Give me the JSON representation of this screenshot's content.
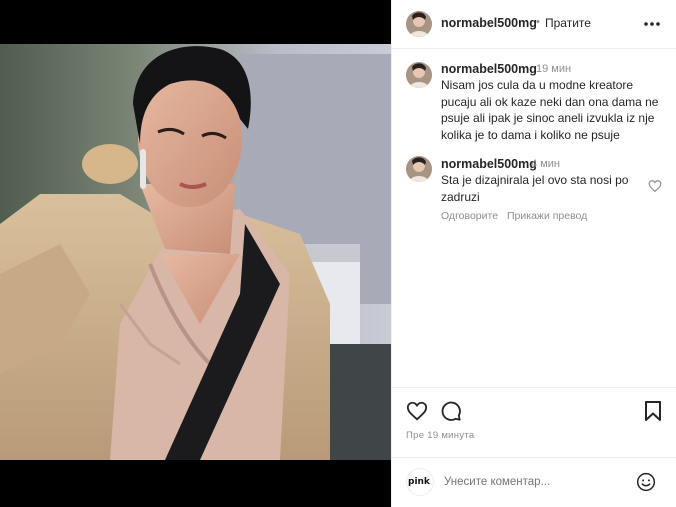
{
  "post": {
    "username": "normabel500mg",
    "dot": "•",
    "follow_label": "Пратите",
    "more_icon": "more-horizontal-icon"
  },
  "comments": [
    {
      "username": "normabel500mg",
      "time": "19 мин",
      "text": "Nisam jos cula da u modne kreatore pucaju ali ok kaze neki dan ona dama ne psuje ali ipak je sinoc aneli izvukla iz nje kolika je to dama i koliko ne psuje"
    },
    {
      "username": "normabel500mg",
      "time": "4 мин",
      "text": "Sta je dizajnirala jel ovo sta nosi po zadruzi",
      "reply_label": "Одговорите",
      "translate_label": "Прикажи превод"
    }
  ],
  "actions": {
    "timestamp": "Пре 19 минута"
  },
  "add_comment": {
    "logo_text": "pink",
    "placeholder": "Унесите коментар...",
    "emoji_icon": "emoji-smile-icon"
  },
  "colors": {
    "text": "#262626",
    "secondary": "#8e8e8e",
    "border": "#efefef",
    "media_bg": "#000000"
  }
}
